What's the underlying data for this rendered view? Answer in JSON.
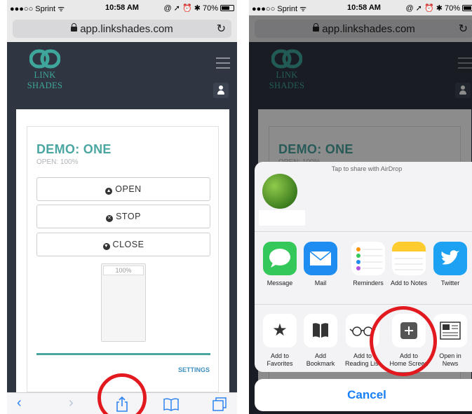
{
  "status": {
    "carrier": "●●●○○ Sprint ᯤ",
    "time": "10:58 AM",
    "indicators": "@ ➚ ⏰ ✱ 70%",
    "battery_pct": 70
  },
  "browser": {
    "url": "app.linkshades.com",
    "reload": "↻"
  },
  "site": {
    "brand": "LINK SHADES",
    "device": {
      "title": "DEMO: ONE",
      "status": "OPEN: 100%"
    },
    "buttons": {
      "open": "OPEN",
      "stop": "STOP",
      "close": "CLOSE"
    },
    "level": {
      "label": "100%",
      "value_pct": 100
    },
    "settings": "SETTINGS"
  },
  "toolbar": {
    "back": "‹",
    "forward": "›",
    "share": "⇪",
    "bookmarks": "📖",
    "tabs": "⧉"
  },
  "share_sheet": {
    "airdrop": "Tap to share with AirDrop",
    "apps": [
      {
        "label": "Message",
        "icon": "message-icon",
        "color": "#34c759"
      },
      {
        "label": "Mail",
        "icon": "mail-icon",
        "color": "#1e8cf0"
      },
      {
        "label": "Reminders",
        "icon": "reminders-icon",
        "color": "#ffffff"
      },
      {
        "label": "Add to Notes",
        "icon": "notes-icon",
        "color": "#fecc2f"
      },
      {
        "label": "Twitter",
        "icon": "twitter-icon",
        "color": "#1da1f2"
      }
    ],
    "actions": [
      {
        "label": "Add to\nFavorites",
        "icon": "star-icon"
      },
      {
        "label": "Add\nBookmark",
        "icon": "book-icon"
      },
      {
        "label": "Add to\nReading List",
        "icon": "glasses-icon"
      },
      {
        "label": "Add to\nHome Screen",
        "icon": "plus-icon"
      },
      {
        "label": "Open in\nNews",
        "icon": "news-icon"
      }
    ],
    "cancel": "Cancel"
  },
  "colors": {
    "accent_teal": "#4aa6a1",
    "highlight_red": "#e21a20",
    "ios_blue": "#1a7ef5"
  }
}
